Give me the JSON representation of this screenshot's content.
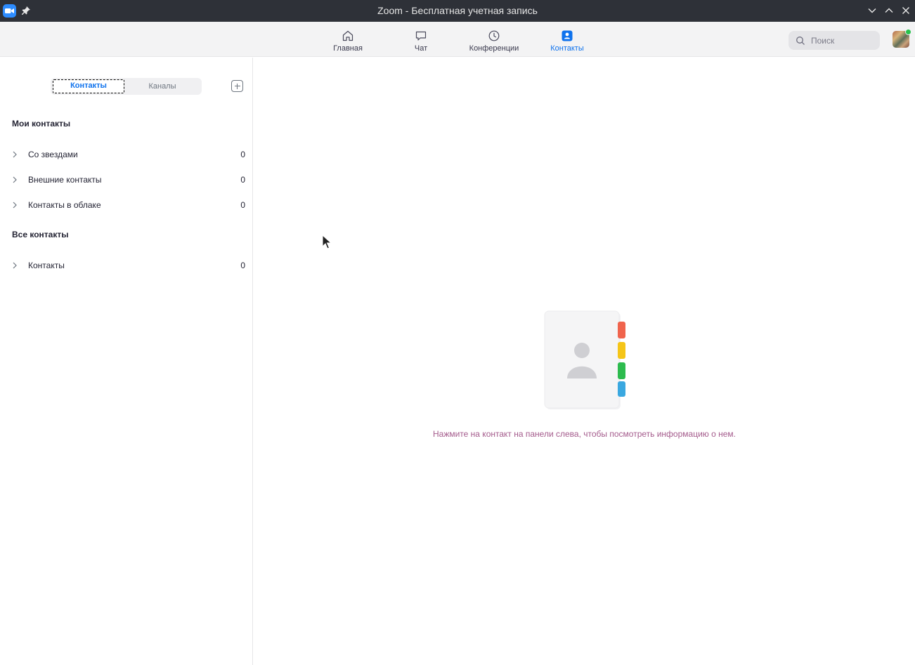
{
  "window": {
    "title": "Zoom - Бесплатная учетная запись"
  },
  "topnav": {
    "tabs": [
      {
        "label": "Главная",
        "icon": "home-icon"
      },
      {
        "label": "Чат",
        "icon": "chat-icon"
      },
      {
        "label": "Конференции",
        "icon": "clock-icon"
      },
      {
        "label": "Контакты",
        "icon": "contacts-icon",
        "active": true
      }
    ],
    "search": {
      "placeholder": "Поиск"
    },
    "accent": "#0e72ed",
    "presence_color": "#27c24c"
  },
  "sidebar": {
    "segments": [
      "Контакты",
      "Каналы"
    ],
    "active_segment": "Контакты",
    "my_contacts": {
      "heading": "Мои контакты",
      "items": [
        {
          "label": "Со звездами",
          "count": "0"
        },
        {
          "label": "Внешние контакты",
          "count": "0"
        },
        {
          "label": "Контакты в облаке",
          "count": "0"
        }
      ]
    },
    "all_contacts": {
      "heading": "Все контакты",
      "items": [
        {
          "label": "Контакты",
          "count": "0"
        }
      ]
    }
  },
  "main": {
    "empty_hint": "Нажмите на контакт на панели слева, чтобы посмотреть информацию о нем.",
    "tab_colors": [
      "#f0644d",
      "#f5c518",
      "#2dbb4e",
      "#3aa8e0"
    ]
  }
}
